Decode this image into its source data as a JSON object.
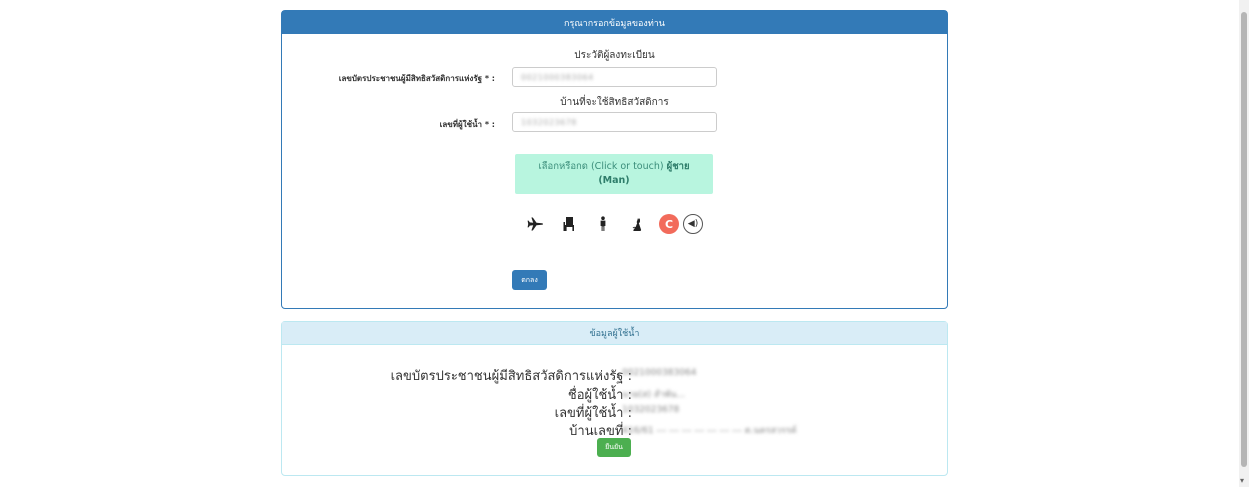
{
  "form": {
    "title": "กรุณากรอกข้อมูลของท่าน",
    "section_registrant": "ประวัติผู้ลงทะเบียน",
    "id_card_label": "เลขบัตรประชาชนผู้มีสิทธิสวัสดิการแห่งรัฐ * :",
    "id_card_value": "0021000383064",
    "section_house": "บ้านที่จะใช้สิทธิสวัสดิการ",
    "water_user_label": "เลขที่ผู้ใช้น้ำ * :",
    "water_user_value": "1032023678",
    "captcha_prefix": "เลือกหรือกด (Click or touch)",
    "captcha_target": "ผู้ชาย",
    "captcha_target_en": "(Man)",
    "captcha_icons": [
      "airplane-icon",
      "chair-icon",
      "man-icon",
      "cat-icon"
    ],
    "refresh_symbol": "C",
    "audio_symbol": "◀)",
    "ok_label": "ตกลง"
  },
  "info": {
    "title": "ข้อมูลผู้ใช้น้ำ",
    "rows": [
      {
        "label": "เลขบัตรประชาชนผู้มีสิทธิสวัสดิการแห่งรัฐ :",
        "value": "0021000383064"
      },
      {
        "label": "ชื่อผู้ใช้น้ำ :",
        "value": "นาย(ส) สำพัน..."
      },
      {
        "label": "เลขที่ผู้ใช้น้ำ :",
        "value": "1032023678"
      },
      {
        "label": "บ้านเลขที่ :",
        "value": "416/61 --- --- --- --- --- --- --- ต.นครสวรรค์"
      }
    ],
    "confirm_label": "ยืนยัน"
  },
  "colors": {
    "primary": "#337ab7",
    "info_heading": "#d9edf7",
    "captcha_bg": "#b8f5df",
    "refresh": "#f26b5b",
    "confirm": "#4caf50"
  }
}
